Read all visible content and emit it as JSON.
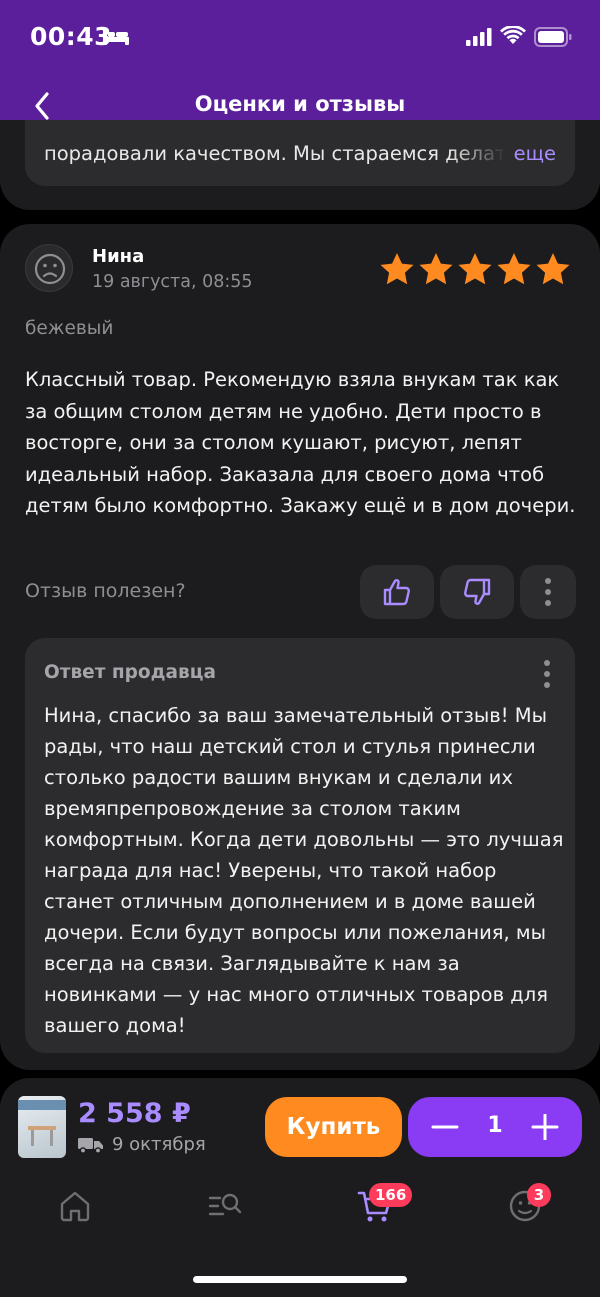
{
  "status_bar": {
    "time": "00:43"
  },
  "header": {
    "title": "Оценки и отзывы"
  },
  "previous_review": {
    "reply_tail": "порадовали качеством. Мы стараемся делать",
    "more_link": "еще"
  },
  "review": {
    "author": "Нина",
    "date": "19 августа, 08:55",
    "rating": 5,
    "rating_max": 5,
    "variant": "бежевый",
    "text": "Классный товар. Рекомендую взяла внукам так как за общим столом детям не удобно. Дети просто в восторге, они за столом кушают, рисуют, лепят идеальный набор. Заказала для своего дома чтоб детям было комфортно. Закажу ещё и в дом дочери.",
    "helpful_label": "Отзыв полезен?",
    "seller_reply": {
      "title": "Ответ продавца",
      "text": "Нина, спасибо за ваш замечательный отзыв! Мы рады, что наш детский стол и стулья принесли столько радости вашим внукам и сделали их времяпрепровождение за столом таким комфортным. Когда дети довольны — это лучшая награда для нас! Уверены, что такой набор станет отличным дополнением и в доме вашей дочери. Если будут вопросы или пожелания, мы всегда на связи. Заглядывайте к нам за новинками — у нас много отличных товаров для вашего дома!"
    }
  },
  "purchase": {
    "price": "2 558 ₽",
    "delivery_date": "9 октября",
    "buy_label": "Купить",
    "quantity": "1"
  },
  "tab_bar": {
    "cart_badge": "166",
    "profile_badge": "3"
  },
  "colors": {
    "header": "#5b1f9c",
    "accent_purple": "#a98cff",
    "stepper_purple": "#8a3cf5",
    "buy_orange": "#ff8a1f",
    "star_orange": "#ff8a1f",
    "badge_red": "#ff3b5c",
    "card_bg": "#1c1c1e"
  }
}
